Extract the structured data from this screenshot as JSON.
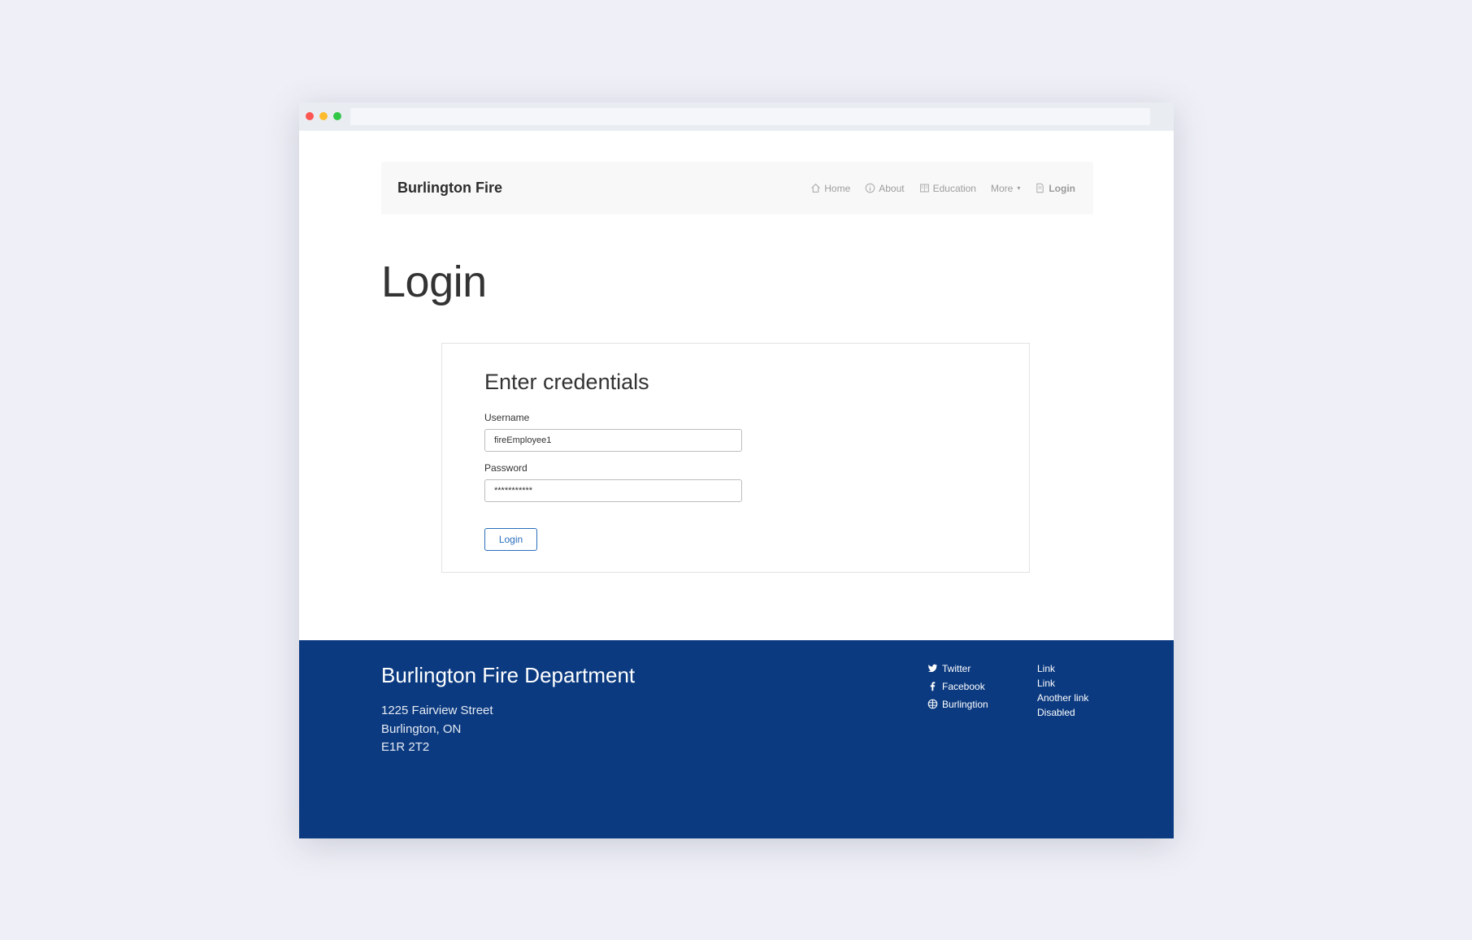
{
  "navbar": {
    "brand": "Burlington Fire",
    "items": [
      {
        "label": "Home",
        "icon": "home-icon"
      },
      {
        "label": "About",
        "icon": "info-icon"
      },
      {
        "label": "Education",
        "icon": "book-icon"
      },
      {
        "label": "More",
        "icon": "caret-down-icon"
      },
      {
        "label": "Login",
        "icon": "document-icon"
      }
    ]
  },
  "page": {
    "title": "Login"
  },
  "form": {
    "title": "Enter credentials",
    "username_label": "Username",
    "username_value": "fireEmployee1",
    "password_label": "Password",
    "password_value": "***********",
    "submit_label": "Login"
  },
  "footer": {
    "title": "Burlington Fire Department",
    "address": [
      "1225 Fairview Street",
      "Burlington, ON",
      "E1R 2T2"
    ],
    "social": [
      {
        "label": "Twitter",
        "icon": "twitter-icon"
      },
      {
        "label": "Facebook",
        "icon": "facebook-icon"
      },
      {
        "label": "Burlingtion",
        "icon": "globe-icon"
      }
    ],
    "links": [
      "Link",
      "Link",
      "Another link",
      "Disabled"
    ]
  },
  "colors": {
    "page_bg": "#eff0f7",
    "footer_bg": "#0b3a80",
    "accent": "#2a6ebb"
  }
}
